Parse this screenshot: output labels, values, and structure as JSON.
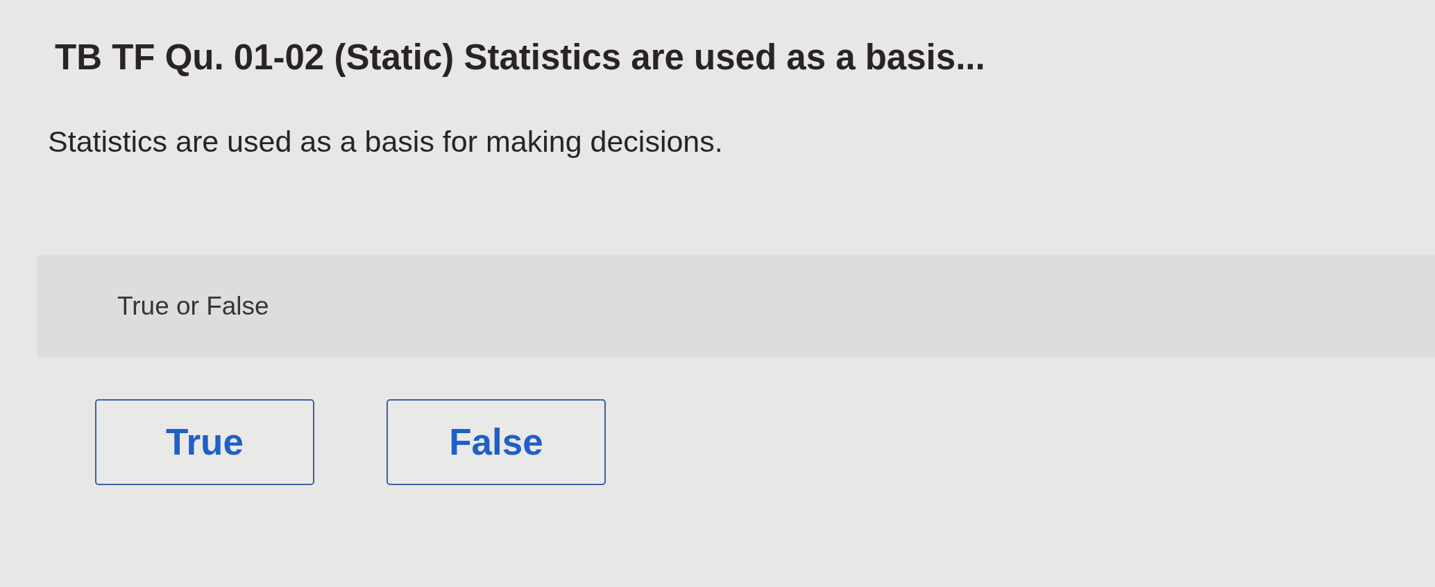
{
  "question": {
    "title": "TB TF Qu. 01-02 (Static) Statistics are used as a basis...",
    "statement": "Statistics are used as a basis for making decisions."
  },
  "answer_panel": {
    "prompt": "True or False"
  },
  "choices": [
    {
      "label": "True"
    },
    {
      "label": "False"
    }
  ]
}
